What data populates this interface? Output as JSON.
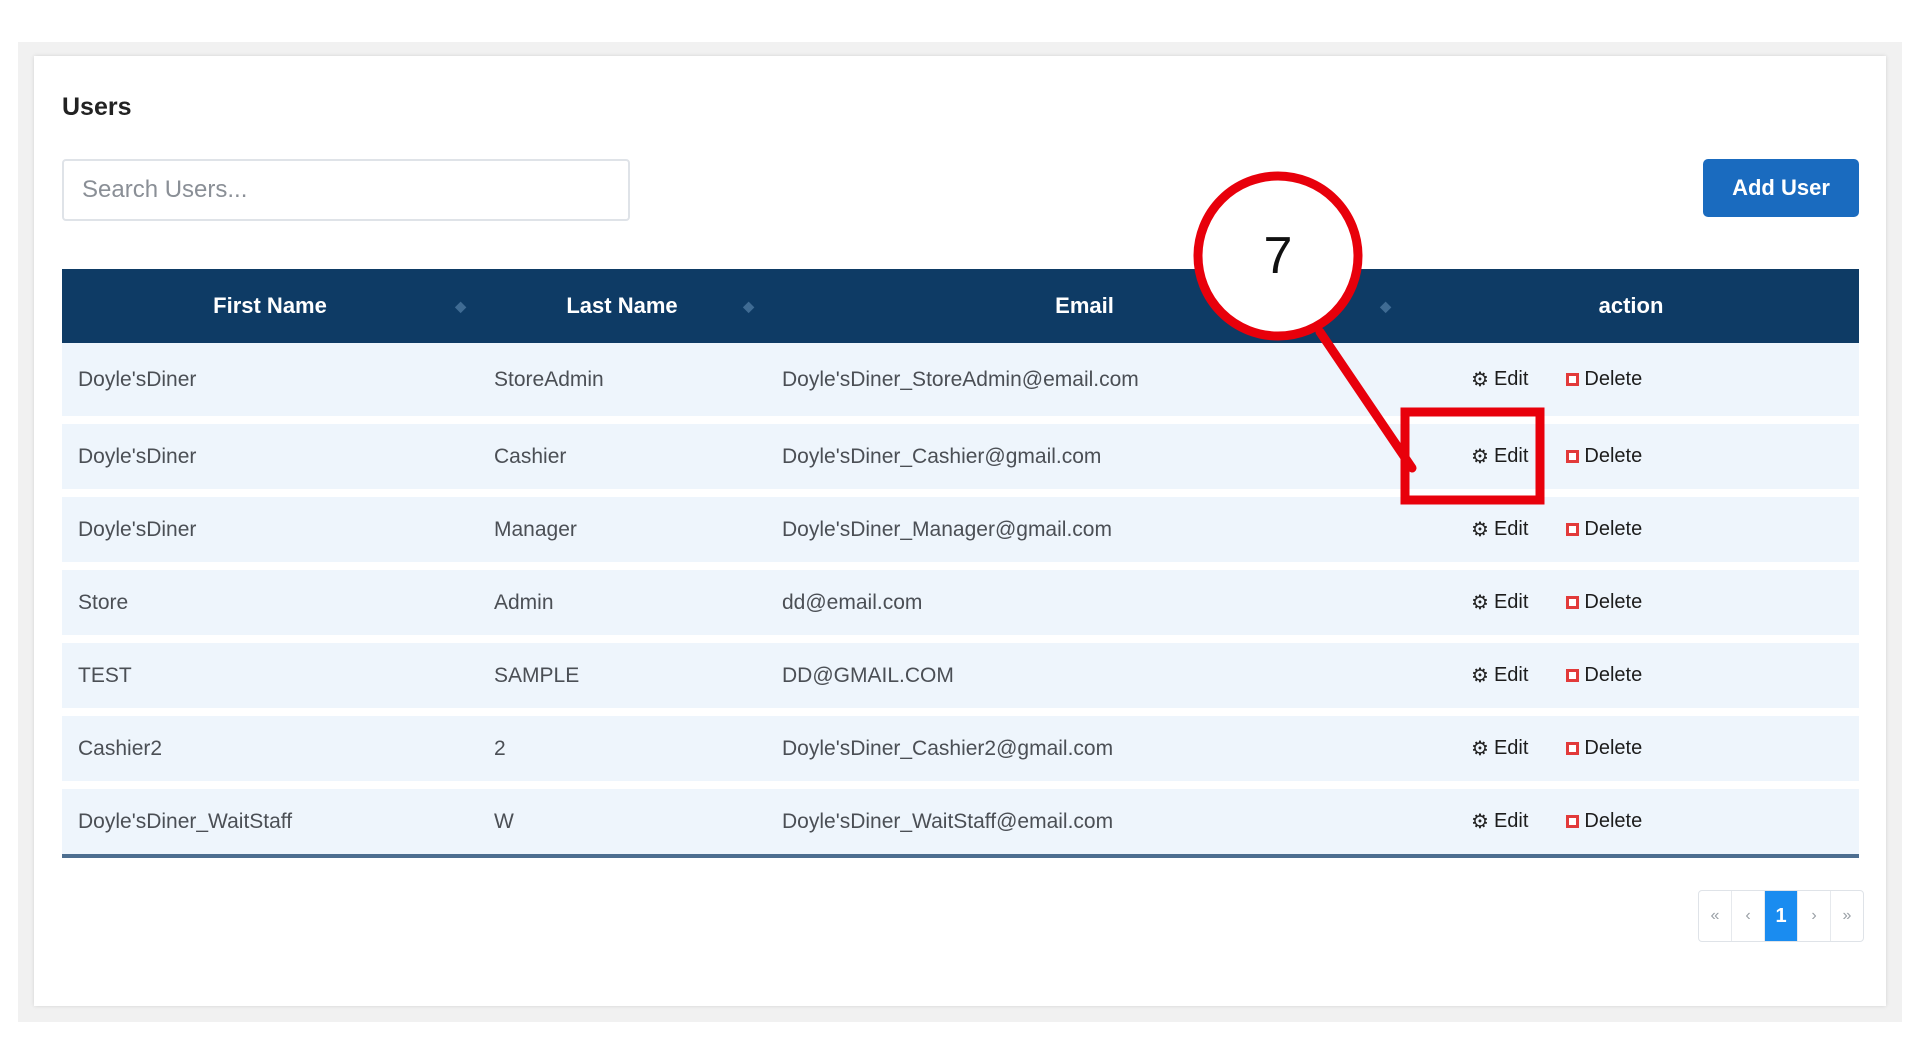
{
  "page": {
    "title": "Users"
  },
  "search": {
    "placeholder": "Search Users..."
  },
  "toolbar": {
    "add_user_label": "Add User"
  },
  "table": {
    "columns": [
      "First Name",
      "Last Name",
      "Email",
      "action"
    ],
    "rows": [
      {
        "first_name": "Doyle'sDiner",
        "last_name": "StoreAdmin",
        "email": "Doyle'sDiner_StoreAdmin@email.com",
        "edit": "Edit",
        "delete": "Delete"
      },
      {
        "first_name": "Doyle'sDiner",
        "last_name": "Cashier",
        "email": "Doyle'sDiner_Cashier@gmail.com",
        "edit": "Edit",
        "delete": "Delete"
      },
      {
        "first_name": "Doyle'sDiner",
        "last_name": "Manager",
        "email": "Doyle'sDiner_Manager@gmail.com",
        "edit": "Edit",
        "delete": "Delete"
      },
      {
        "first_name": "Store",
        "last_name": "Admin",
        "email": "dd@email.com",
        "edit": "Edit",
        "delete": "Delete"
      },
      {
        "first_name": "TEST",
        "last_name": "SAMPLE",
        "email": "DD@GMAIL.COM",
        "edit": "Edit",
        "delete": "Delete"
      },
      {
        "first_name": "Cashier2",
        "last_name": "2",
        "email": "Doyle'sDiner_Cashier2@gmail.com",
        "edit": "Edit",
        "delete": "Delete"
      },
      {
        "first_name": "Doyle'sDiner_WaitStaff",
        "last_name": "W",
        "email": "Doyle'sDiner_WaitStaff@email.com",
        "edit": "Edit",
        "delete": "Delete"
      }
    ]
  },
  "pagination": {
    "first": "«",
    "prev": "‹",
    "current": "1",
    "next": "›",
    "last": "»"
  },
  "annotation": {
    "step_number": "7",
    "color": "#e8000b"
  },
  "colors": {
    "header_bg": "#0e3b65",
    "row_bg": "#eef5fc",
    "accent": "#1a6bbf",
    "active_page": "#1a8cf0",
    "delete_icon": "#e23a3a"
  },
  "icons": {
    "edit": "gear-icon",
    "delete": "delete-square-icon",
    "sort": "sort-icon"
  }
}
